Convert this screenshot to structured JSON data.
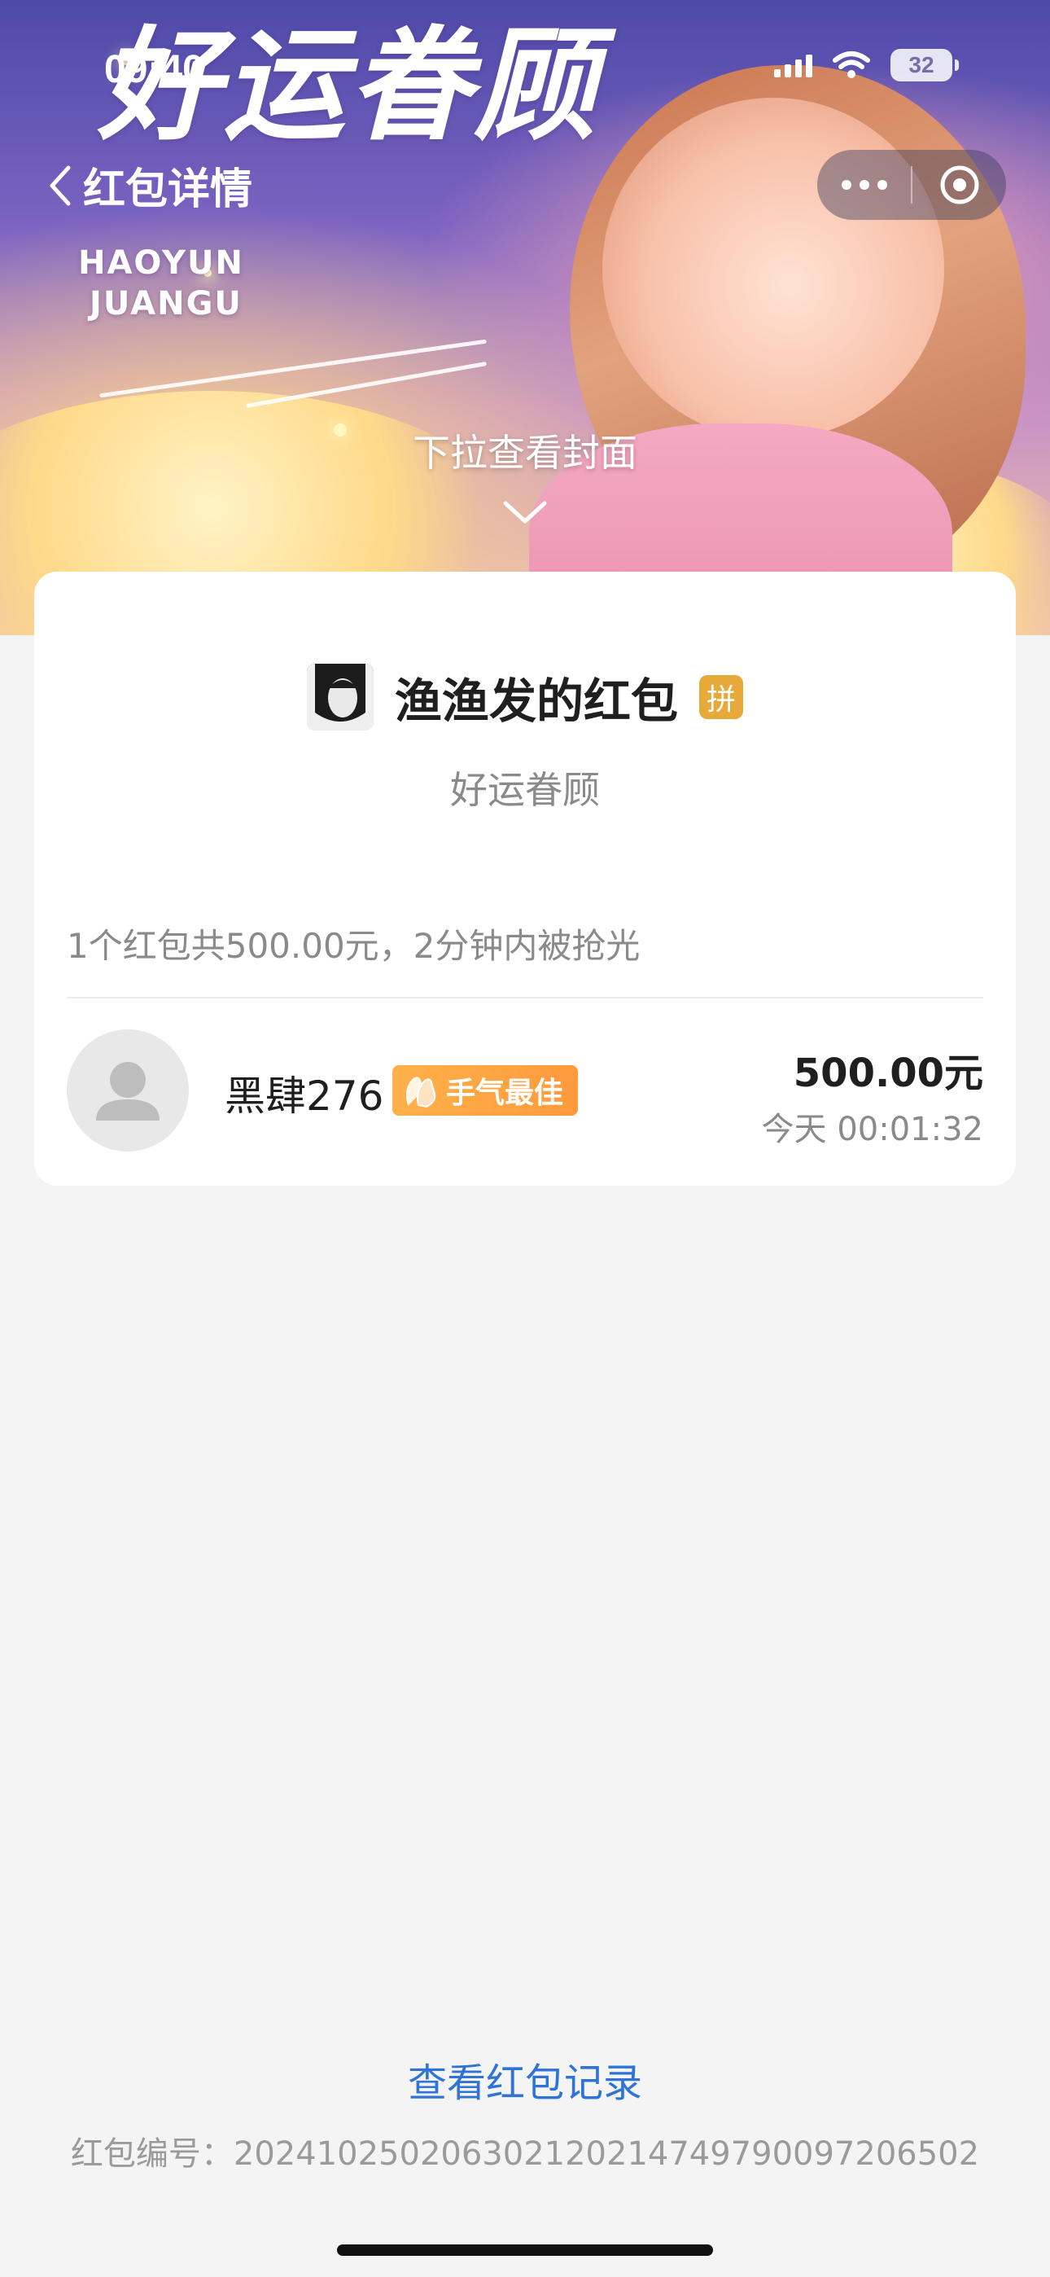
{
  "status_bar": {
    "time": "09:40",
    "battery": "32"
  },
  "nav": {
    "title": "红包详情"
  },
  "cover": {
    "art_text_large": "好运眷顾",
    "art_text_latin_1": "HAOYUN",
    "art_text_latin_2": "JUANGU",
    "pull_hint": "下拉查看封面"
  },
  "envelope": {
    "sender_title": "渔渔发的红包",
    "pin_badge": "拼",
    "greeting": "好运眷顾"
  },
  "summary": "1个红包共500.00元，2分钟内被抢光",
  "receivers": [
    {
      "name": "黑肆276",
      "badge": "手气最佳",
      "amount": "500.00元",
      "time": "今天 00:01:32"
    }
  ],
  "footer": {
    "record_link": "查看红包记录",
    "serial": "红包编号：20241025020630212021474979009720650​2"
  },
  "colors": {
    "link": "#2f73d6",
    "badge": "#ff9a3c",
    "pin": "#e7a93a"
  }
}
